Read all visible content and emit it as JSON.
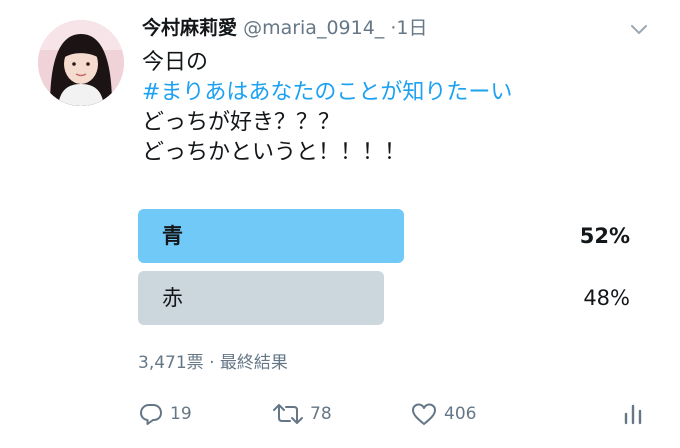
{
  "tweet": {
    "author_name": "今村麻莉愛",
    "handle": "@maria_0914_",
    "separator": "·",
    "time": "1日",
    "lines": {
      "line1": "今日の",
      "hashtag": "#まりあはあなたのことが知りたーい",
      "line3": "どっちが好き？？？",
      "line4": "どっちかというと！！！！"
    }
  },
  "poll": {
    "options": [
      {
        "label": "青",
        "percent_text": "52%",
        "percent": 52,
        "winner": true
      },
      {
        "label": "赤",
        "percent_text": "48%",
        "percent": 48,
        "winner": false
      }
    ],
    "meta": "3,471票 · 最終結果"
  },
  "actions": {
    "replies": "19",
    "retweets": "78",
    "likes": "406"
  },
  "colors": {
    "accent": "#1da1f2",
    "winner_bar": "#71c9f8",
    "other_bar": "#ccd6dd",
    "muted_text": "#657786"
  },
  "icons": [
    "avatar",
    "chevron-down-icon",
    "reply-icon",
    "retweet-icon",
    "like-icon",
    "analytics-icon"
  ]
}
